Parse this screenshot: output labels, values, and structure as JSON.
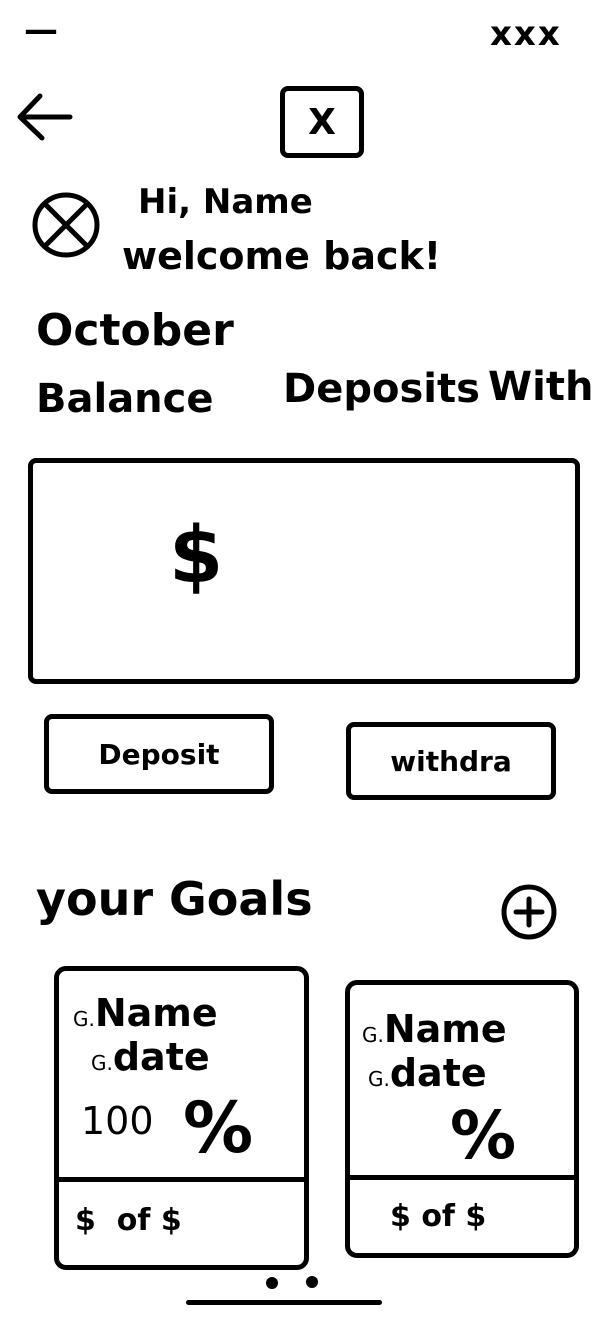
{
  "status_bar": {
    "left": "—",
    "right": "xxx"
  },
  "header": {
    "back_icon": "arrow-left-icon",
    "logo_icon": "close-box-icon",
    "logo_glyph": "X"
  },
  "greeting": {
    "avatar_icon": "avatar-placeholder-icon",
    "line1": "Hi, Name",
    "line2": "welcome back!"
  },
  "month": "October",
  "tabs": [
    {
      "label": "Balance"
    },
    {
      "label": "Deposits"
    },
    {
      "label": "With"
    }
  ],
  "balance_card": {
    "currency": "$"
  },
  "actions": {
    "deposit_label": "Deposit",
    "withdraw_label": "withdra"
  },
  "goals": {
    "title": "your Goals",
    "add_icon": "plus-circle-icon",
    "items": [
      {
        "name_prefix": "G.",
        "name": "Name",
        "date_prefix": "G.",
        "date": "date",
        "progress_text": "100",
        "percent_sign": "%",
        "amount_text": "$  of $"
      },
      {
        "name_prefix": "G.",
        "name": "Name",
        "date_prefix": "G.",
        "date": "date",
        "progress_text": "",
        "percent_sign": "%",
        "amount_text": "$ of $"
      }
    ]
  },
  "pagination": {
    "dots": 2
  }
}
